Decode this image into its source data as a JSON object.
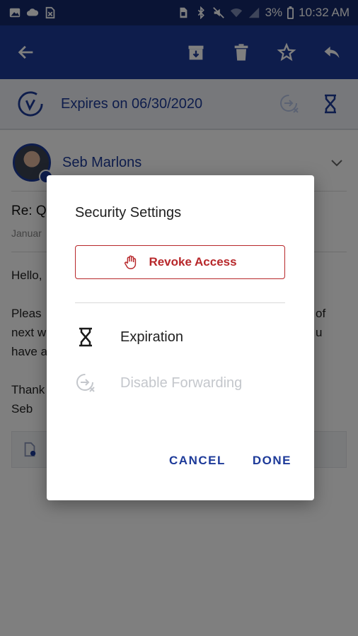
{
  "status_bar": {
    "battery_percent": "3%",
    "time": "10:32 AM",
    "icons": [
      "gallery-icon",
      "cloud-icon",
      "file-x-icon",
      "sim-icon",
      "bluetooth-icon",
      "mute-icon",
      "wifi-icon",
      "signal-icon",
      "battery-icon"
    ]
  },
  "app_bar": {
    "icons": [
      "back-arrow-icon",
      "archive-icon",
      "trash-icon",
      "star-icon",
      "reply-icon"
    ]
  },
  "expiration_bar": {
    "text": "Expires on 06/30/2020",
    "icons": [
      "brand-logo-icon",
      "forwarding-disabled-icon",
      "hourglass-icon"
    ]
  },
  "message": {
    "sender_name": "Seb Marlons",
    "subject_partial": "Re: Q",
    "date_partial": "Januar",
    "body_lines": [
      "Hello,",
      "Pleas",
      "next w",
      "have a",
      "Thank",
      "Seb"
    ],
    "right_fragments": [
      "of",
      "u"
    ]
  },
  "dialog": {
    "title": "Security Settings",
    "revoke_label": "Revoke Access",
    "options": [
      {
        "label": "Expiration",
        "icon": "hourglass-icon",
        "enabled": true
      },
      {
        "label": "Disable Forwarding",
        "icon": "forwarding-disabled-icon",
        "enabled": false
      }
    ],
    "cancel_label": "CANCEL",
    "done_label": "DONE"
  },
  "colors": {
    "status_bar": "#14286a",
    "app_bar": "#1d3a99",
    "accent_blue": "#1d3a99",
    "revoke_red": "#b7272a",
    "disabled_gray": "#c4c7cc"
  }
}
